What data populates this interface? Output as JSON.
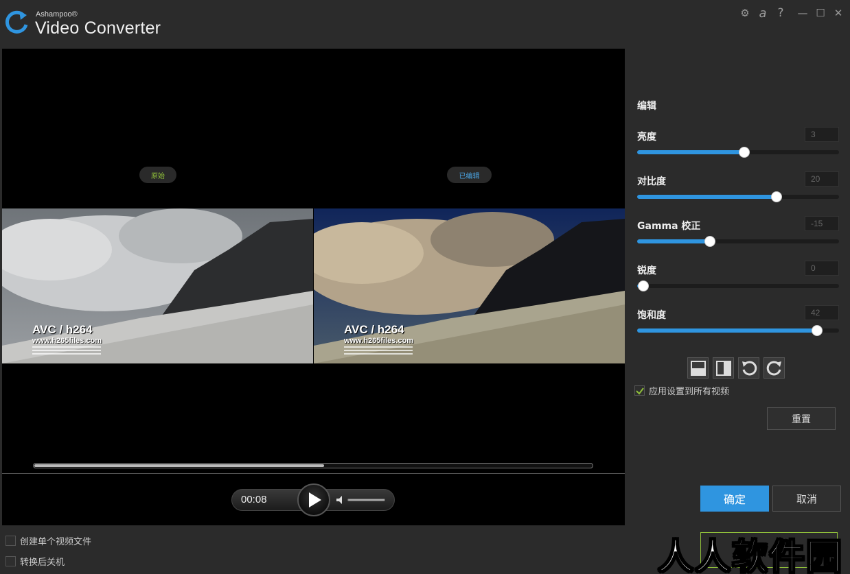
{
  "app": {
    "brand_small": "Ashampoo®",
    "brand_name": "Video Converter"
  },
  "window_controls": [
    "gear-icon",
    "ashampoo-a-icon",
    "help-icon",
    "minimize-icon",
    "maximize-icon",
    "close-icon"
  ],
  "window_glyphs": {
    "gear": "⚙",
    "a": "a",
    "help": "?",
    "minimize": "—",
    "maximize": "☐",
    "close": "✕"
  },
  "preview": {
    "label_original": "原始",
    "label_edited": "已编辑",
    "overlay_title": "AVC / h264",
    "overlay_url": "www.h265files.com",
    "progress_fraction": 0.52,
    "time": "00:08",
    "volume_fraction": 1.0
  },
  "bottom_options": {
    "single_file": "创建单个视频文件",
    "shutdown": "转换后关机"
  },
  "panel": {
    "title": "编辑",
    "sliders": [
      {
        "label": "亮度",
        "value": "3",
        "fraction": 0.53
      },
      {
        "label": "对比度",
        "value": "20",
        "fraction": 0.69
      },
      {
        "label": "Gamma 校正",
        "value": "-15",
        "fraction": 0.36
      },
      {
        "label": "锐度",
        "value": "0",
        "fraction": 0.03
      },
      {
        "label": "饱和度",
        "value": "42",
        "fraction": 0.89
      }
    ],
    "tools": [
      "split-horizontal-icon",
      "split-vertical-icon",
      "rotate-left-icon",
      "rotate-right-icon"
    ],
    "apply_all": "应用设置到所有视频",
    "apply_all_checked": true,
    "reset": "重置",
    "ok": "确定",
    "cancel": "取消"
  },
  "colors": {
    "accent": "#2f95e0",
    "green": "#8fbf3a",
    "background": "#2b2b2b"
  },
  "watermark": "人人软件园"
}
